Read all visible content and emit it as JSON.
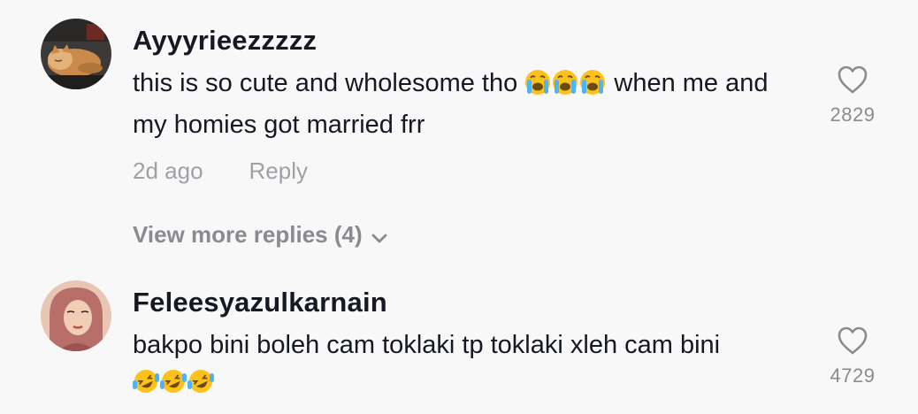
{
  "comments": [
    {
      "username": "Ayyyrieezzzzz",
      "text_before": "this is so cute and wholesome tho",
      "emojis": [
        "loudly-crying-face",
        "loudly-crying-face",
        "loudly-crying-face"
      ],
      "text_after": "when me and my homies got married frr",
      "like_count": "2829",
      "time": "2d ago",
      "reply_label": "Reply",
      "view_more": "View more replies (4)",
      "avatar": "cat-sleeping-avatar"
    },
    {
      "username": "Feleesyazulkarnain",
      "text_before": "bakpo bini boleh cam toklaki tp toklaki xleh cam bini",
      "emojis": [
        "rolling-on-floor-laughing",
        "rolling-on-floor-laughing",
        "rolling-on-floor-laughing"
      ],
      "text_after": "",
      "like_count": "4729",
      "avatar": "woman-hijab-avatar"
    }
  ],
  "colors": {
    "background": "#f8f8f8",
    "primary_text": "#161823",
    "secondary_text": "#8a8b91",
    "emoji_yellow": "#fcc21b",
    "tear_blue": "#4fb3f6"
  }
}
